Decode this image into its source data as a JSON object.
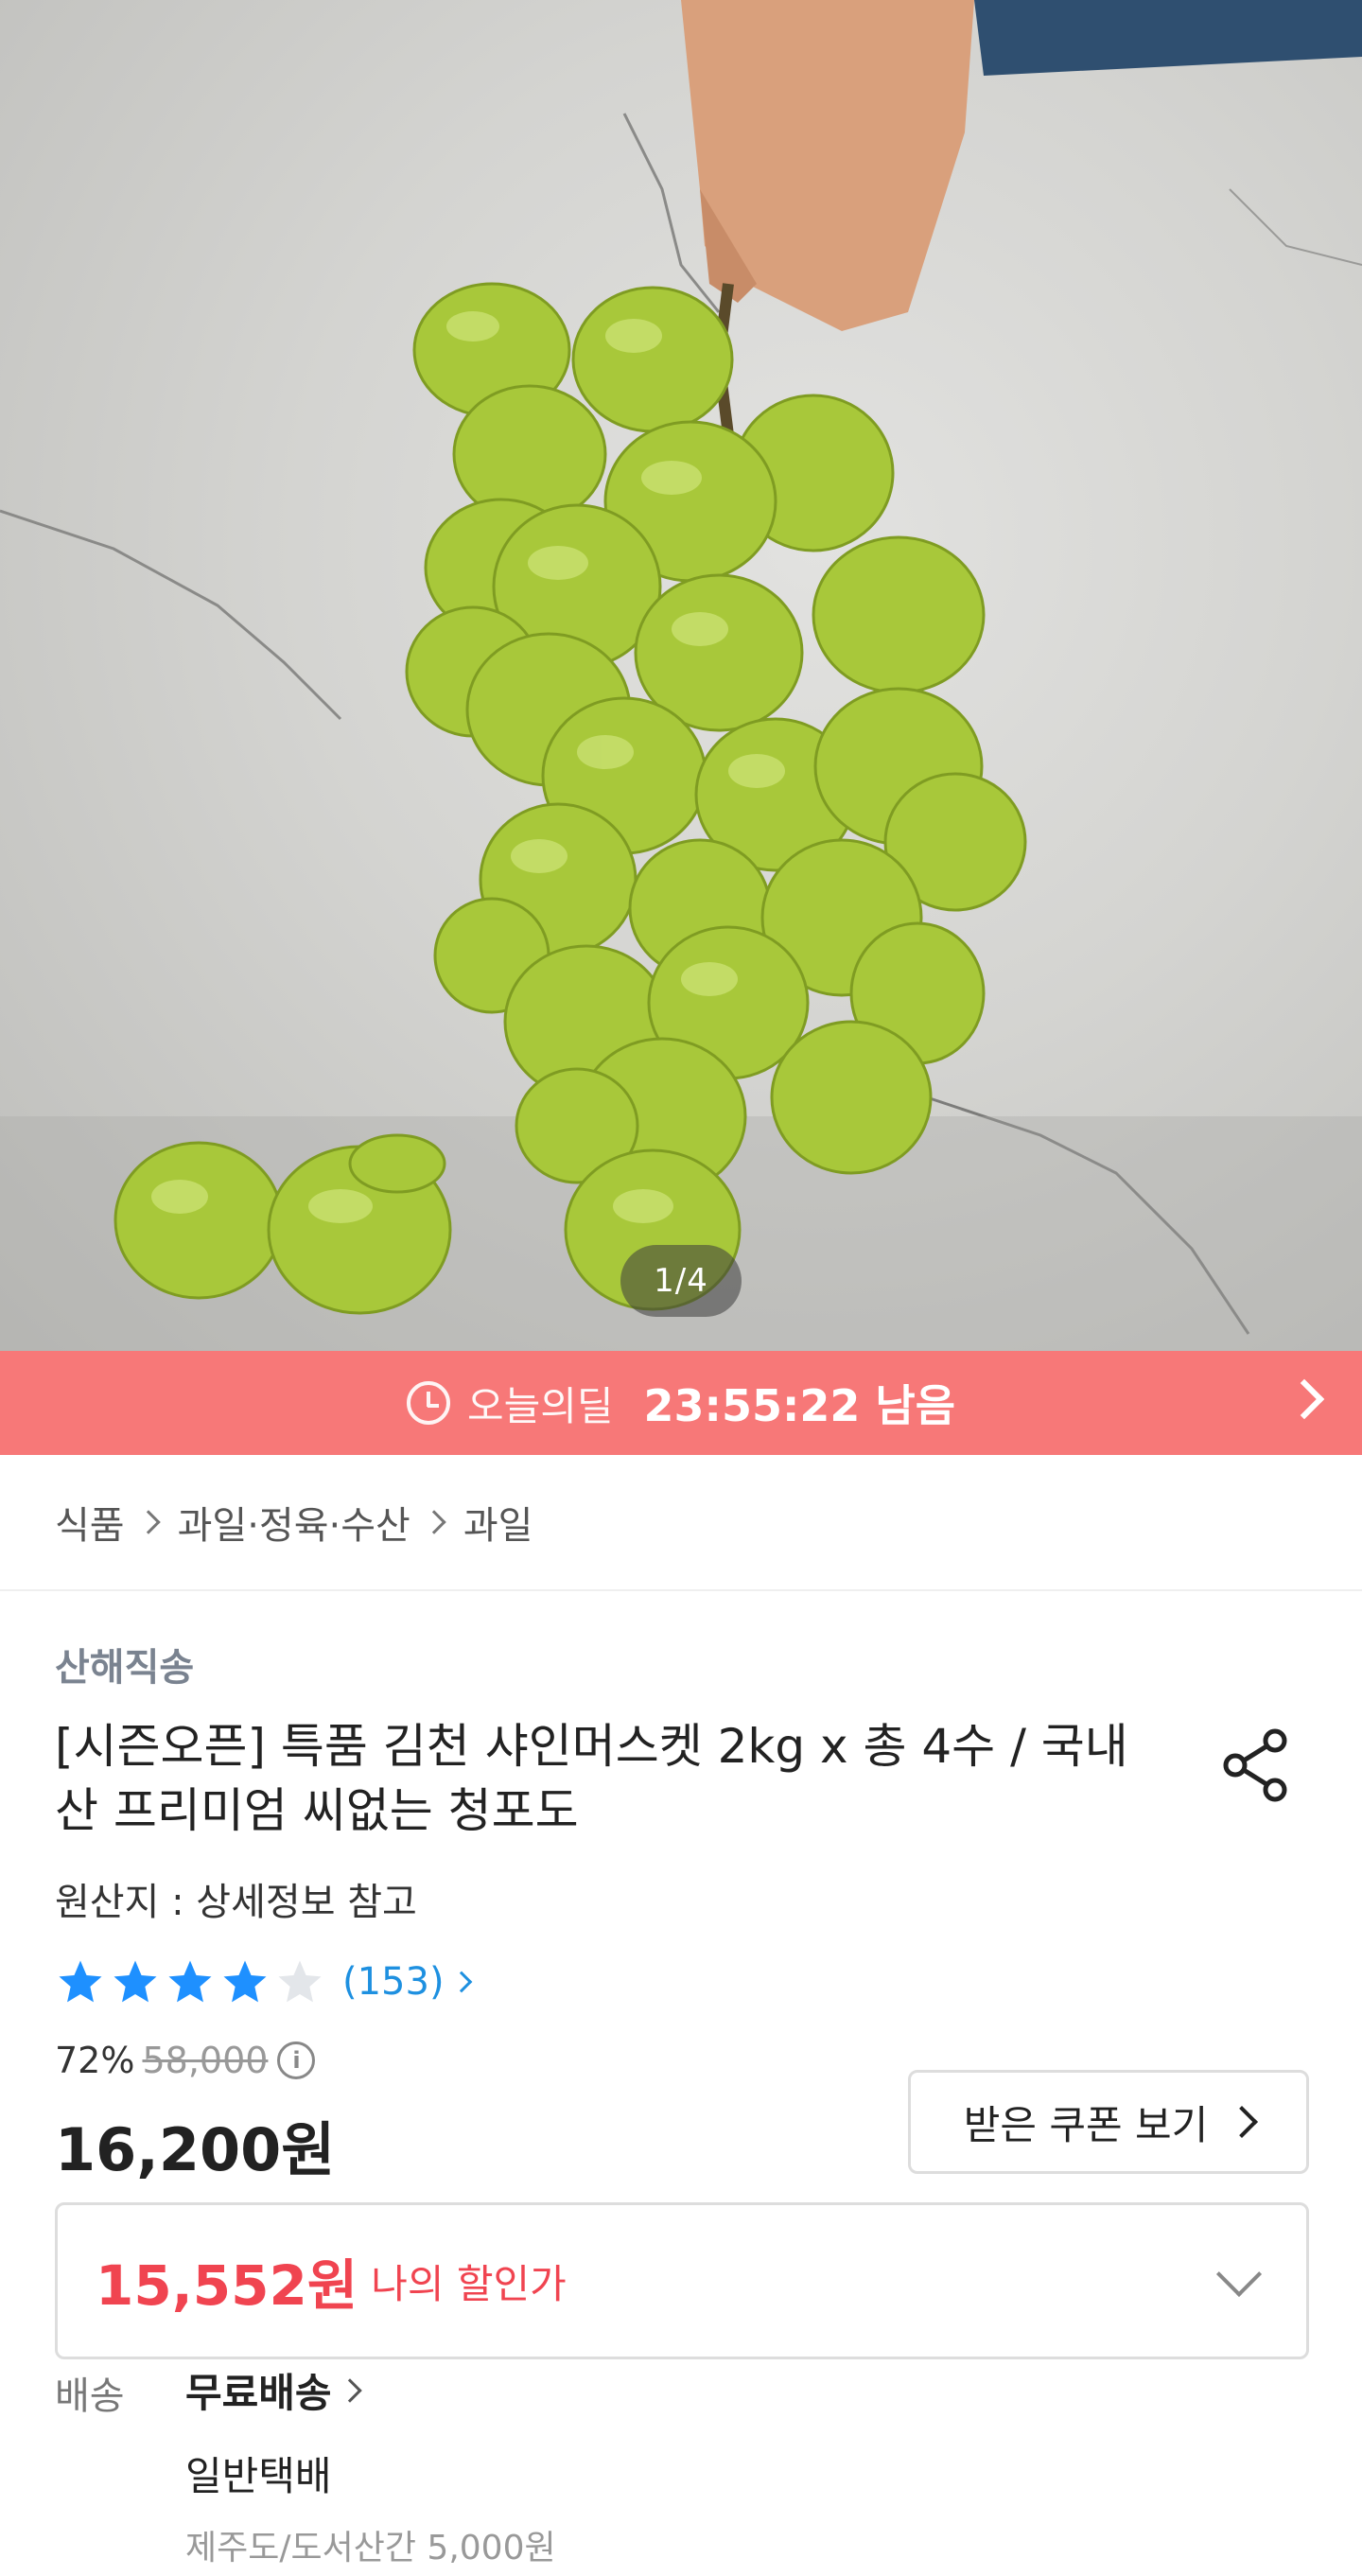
{
  "hero": {
    "page_indicator": "1/4",
    "image_subject": "green-grape-bunch-photo"
  },
  "deal": {
    "label": "오늘의딜",
    "time_remaining": "23:55:22 남음",
    "color": "#f77878"
  },
  "breadcrumb": {
    "items": [
      "식품",
      "과일·정육·수산",
      "과일"
    ]
  },
  "product": {
    "seller": "산해직송",
    "title": "[시즌오픈] 특품 김천 샤인머스켓 2kg x 총 4수 / 국내산 프리미엄 씨없는 청포도",
    "origin": "원산지 : 상세정보 참고",
    "rating": 4,
    "rating_max": 5,
    "review_count": "(153)",
    "discount_rate": "72%",
    "original_price": "58,000",
    "price": "16,200원"
  },
  "coupon": {
    "label": "받은 쿠폰 보기"
  },
  "my_discount": {
    "price": "15,552원",
    "label": "나의 할인가",
    "color": "#f04450"
  },
  "shipping": {
    "label": "배송",
    "free": "무료배송",
    "type": "일반택배",
    "extra": "제주도/도서산간 5,000원"
  },
  "icons": [
    "clock-icon",
    "chevron-right-icon",
    "share-icon",
    "star-icon",
    "info-icon",
    "chevron-down-icon"
  ]
}
